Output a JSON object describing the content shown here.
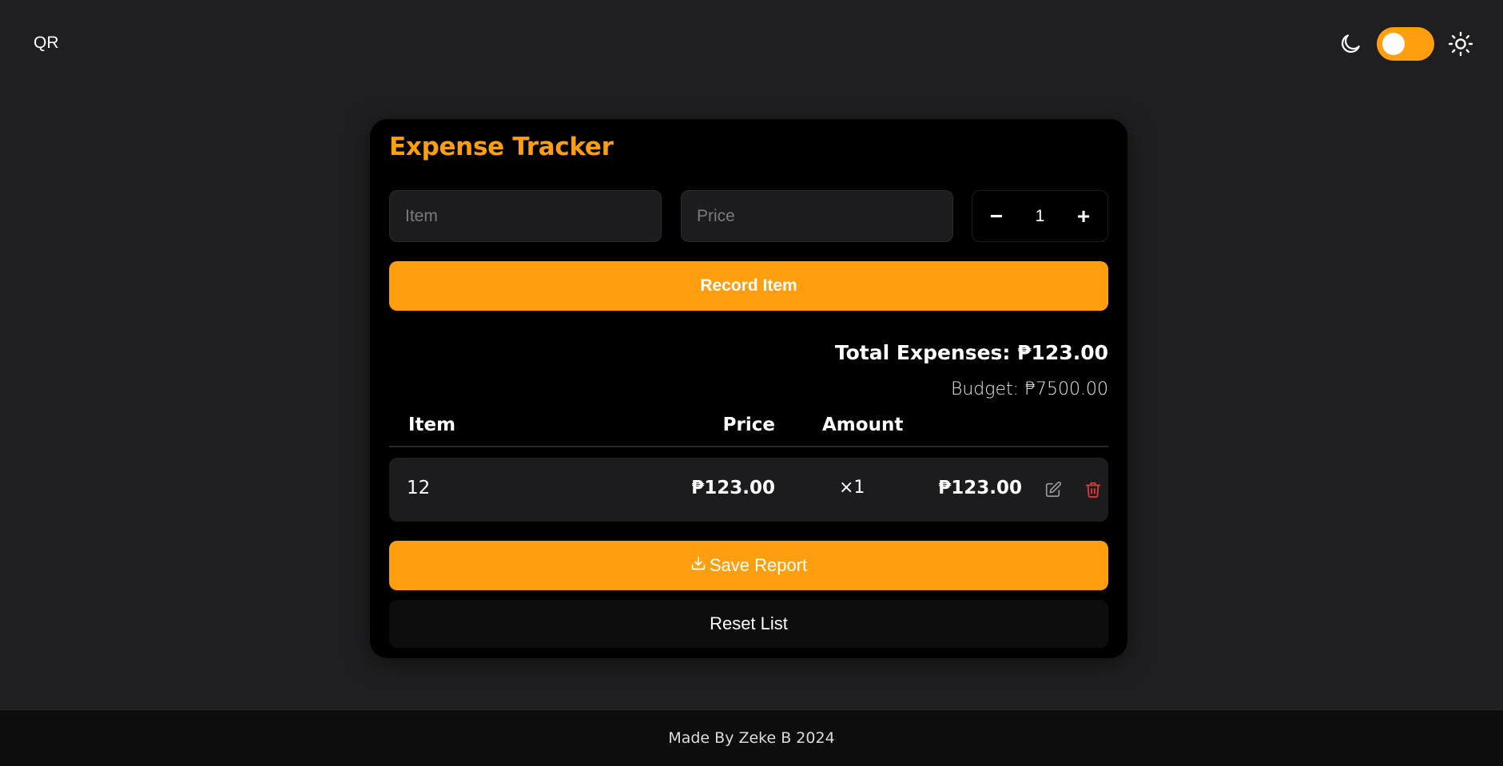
{
  "header": {
    "qr_label": "QR",
    "theme": {
      "dark_icon": "moon-icon",
      "light_icon": "sun-icon",
      "toggle_on": true
    }
  },
  "tracker": {
    "title": "Expense Tracker",
    "item_placeholder": "Item",
    "price_placeholder": "Price",
    "stepper": {
      "minus": "−",
      "value": "1",
      "plus": "+"
    },
    "record_label": "Record Item",
    "total_label": "Total Expenses: ₱123.00",
    "budget_label": "Budget: ₱7500.00",
    "columns": {
      "item": "Item",
      "price": "Price",
      "amount": "Amount"
    },
    "rows": [
      {
        "item": "12",
        "price": "₱123.00",
        "amount": "×1",
        "total": "₱123.00"
      }
    ],
    "save_label": "Save Report",
    "reset_label": "Reset List"
  },
  "footer": {
    "text": "Made By Zeke B 2024"
  },
  "colors": {
    "accent": "#ff9f0f",
    "delete": "#e53935",
    "background": "#1f1f21",
    "card": "#000000"
  }
}
